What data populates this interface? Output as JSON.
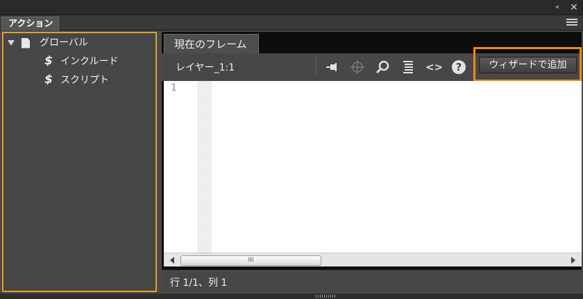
{
  "window": {
    "collapse_glyph": "‹‹",
    "close_glyph": "✕",
    "panel_tab_label": "アクション",
    "panel_menu_icon": "hamburger-menu-icon"
  },
  "tree": {
    "items": [
      {
        "label": "グローバル",
        "icon": "document-icon",
        "expanded": true
      },
      {
        "label": "インクルード",
        "icon": "script-icon"
      },
      {
        "label": "スクリプト",
        "icon": "script-icon"
      }
    ]
  },
  "editor": {
    "frame_tab_label": "現在のフレーム",
    "layer_label": "レイヤー_1:1",
    "tools": [
      "pin-icon",
      "target-icon",
      "find-icon",
      "format-code-icon",
      "code-hint-icon",
      "help-icon"
    ],
    "code_hint_glyph": "<>",
    "help_glyph": "?",
    "wizard_button_label": "ウィザードで追加",
    "line_numbers": [
      "1"
    ],
    "scroll_thumb_grip": "III",
    "status_text": "行 1/1、列 1"
  },
  "colors": {
    "highlight_orange": "#f28c13",
    "tree_border": "#e5a021",
    "panel_bg": "#474747",
    "editor_bg": "#ffffff"
  }
}
